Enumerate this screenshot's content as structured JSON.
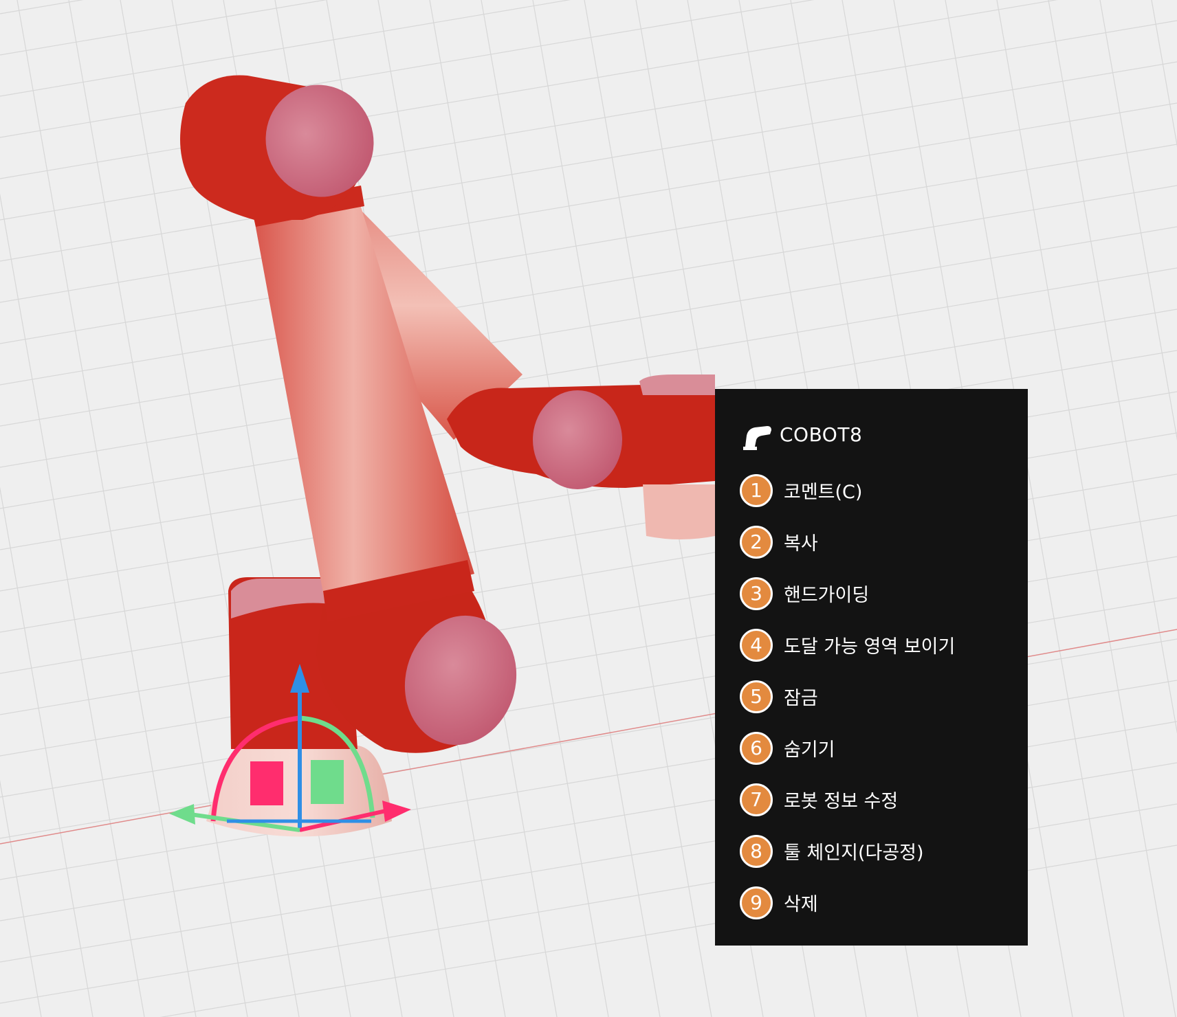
{
  "viewport": {
    "background": "#efefef",
    "robot_color": "#cc2a1e",
    "joint_cap_color": "#c9607a",
    "gizmo_colors": {
      "x": "#ff2d6e",
      "y": "#6fdc8c",
      "z": "#2f8fe6"
    }
  },
  "context_menu": {
    "background": "#131313",
    "badge_color": "#e38a3f",
    "header": {
      "icon": "robot-arm-icon",
      "title": "COBOT8"
    },
    "items": [
      {
        "number": "1",
        "label": "코멘트(C)"
      },
      {
        "number": "2",
        "label": "복사"
      },
      {
        "number": "3",
        "label": "핸드가이딩"
      },
      {
        "number": "4",
        "label": "도달 가능 영역 보이기"
      },
      {
        "number": "5",
        "label": "잠금"
      },
      {
        "number": "6",
        "label": "숨기기"
      },
      {
        "number": "7",
        "label": "로봇 정보 수정"
      },
      {
        "number": "8",
        "label": "툴 체인지(다공정)"
      },
      {
        "number": "9",
        "label": "삭제"
      }
    ]
  }
}
